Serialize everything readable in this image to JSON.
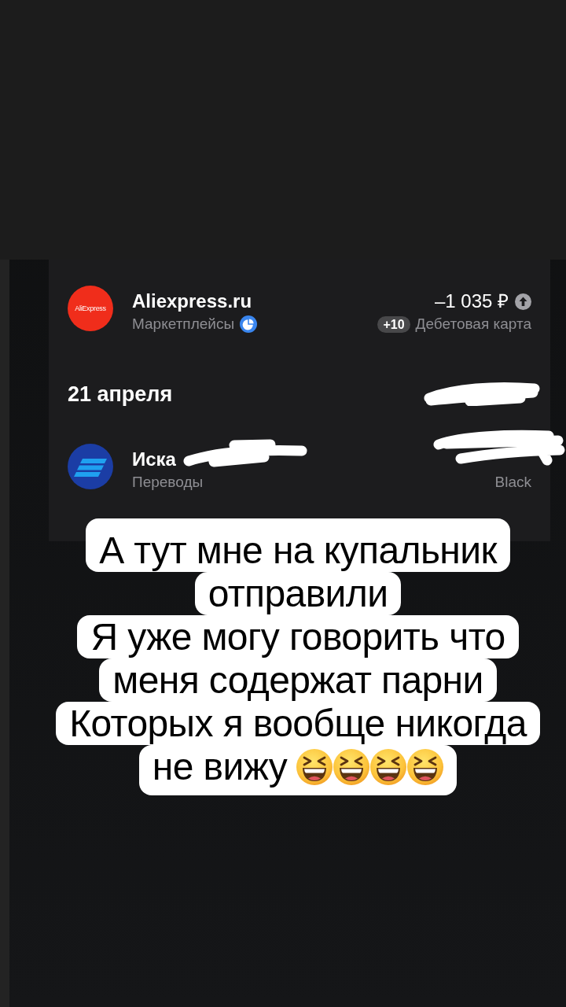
{
  "story": {
    "screenshot": {
      "items": [
        {
          "kind": "transaction",
          "logo": {
            "kind": "text",
            "text": "AliExpress",
            "color": "#f02d1b"
          },
          "name": "Aliexpress.ru",
          "category": "Маркетплейсы",
          "category_icon": true,
          "amount": "–1 035 ₽",
          "amount_icon": true,
          "cashback": "+10",
          "account": "Дебетовая карта"
        },
        {
          "kind": "date",
          "label": "21 апреля",
          "total_redacted": true
        },
        {
          "kind": "transaction",
          "logo": {
            "kind": "transfer",
            "color": "#1b3da5"
          },
          "name": "Иска",
          "name_redacted": true,
          "category": "Переводы",
          "amount_redacted": true,
          "account": "Black"
        }
      ]
    },
    "caption": {
      "lines": [
        "А тут мне на купальник",
        "отправили",
        "Я уже могу говорить что",
        "меня содержат парни",
        "Которых я вообще никогда",
        "не вижу"
      ],
      "emojis": [
        {
          "kind": "laughing"
        },
        {
          "kind": "laughing"
        },
        {
          "kind": "laughing"
        },
        {
          "kind": "laughing"
        }
      ]
    }
  }
}
